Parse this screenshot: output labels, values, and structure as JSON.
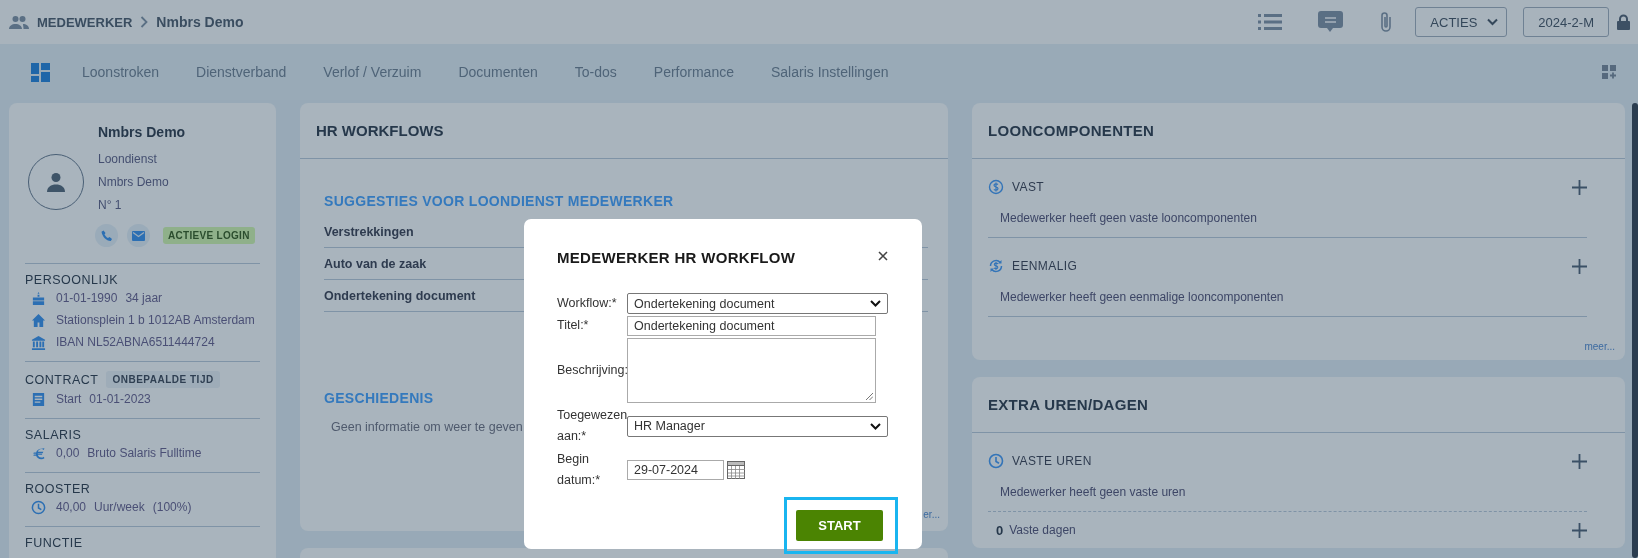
{
  "breadcrumb": {
    "section": "MEDEWERKER",
    "page": "Nmbrs Demo"
  },
  "header_buttons": {
    "actions": "ACTIES",
    "period": "2024-2-M"
  },
  "tabs": [
    {
      "kind": "icon",
      "selected": true
    },
    {
      "kind": "text",
      "label": "Loonstroken",
      "selected": false
    },
    {
      "kind": "text",
      "label": "Dienstverband",
      "selected": false
    },
    {
      "kind": "text",
      "label": "Verlof / Verzuim",
      "selected": false
    },
    {
      "kind": "text",
      "label": "Documenten",
      "selected": false
    },
    {
      "kind": "text",
      "label": "To-dos",
      "selected": false
    },
    {
      "kind": "text",
      "label": "Performance",
      "selected": false
    },
    {
      "kind": "text",
      "label": "Salaris Instellingen",
      "selected": false
    }
  ],
  "profile": {
    "name": "Nmbrs Demo",
    "lines": [
      "Loondienst",
      "Nmbrs Demo",
      "N° 1"
    ],
    "badge": "ACTIEVE LOGIN",
    "sections": [
      {
        "title": "PERSOONLIJK",
        "rows": [
          {
            "parts": [
              "01-01-1990",
              "34 jaar"
            ]
          },
          {
            "parts": [
              "Stationsplein 1 b 1012AB Amsterdam"
            ]
          },
          {
            "parts": [
              "IBAN NL52ABNA6511444724"
            ]
          }
        ]
      },
      {
        "title": "CONTRACT",
        "tag": "ONBEPAALDE TIJD",
        "rows": [
          {
            "parts": [
              "Start",
              "01-01-2023"
            ]
          }
        ]
      },
      {
        "title": "SALARIS",
        "rows": [
          {
            "parts": [
              "0,00",
              "Bruto Salaris Fulltime"
            ]
          }
        ]
      },
      {
        "title": "ROOSTER",
        "rows": [
          {
            "parts": [
              "40,00",
              "Uur/week",
              "(100%)"
            ]
          }
        ]
      },
      {
        "title": "FUNCTIE"
      }
    ]
  },
  "hr_workflows": {
    "title": "HR WORKFLOWS",
    "suggestions_title": "SUGGESTIES VOOR LOONDIENST MEDEWERKER",
    "suggestions": [
      "Verstrekkingen",
      "Auto van de zaak",
      "Ondertekening document"
    ],
    "history_title": "GESCHIEDENIS",
    "history_empty": "Geen informatie om weer te geven",
    "more_link": "er..."
  },
  "looncomponenten": {
    "title": "LOONCOMPONENTEN",
    "groups": [
      {
        "title": "VAST",
        "empty": "Medewerker heeft geen vaste looncomponenten"
      },
      {
        "title": "EENMALIG",
        "empty": "Medewerker heeft geen eenmalige looncomponenten"
      }
    ],
    "more_link": "meer..."
  },
  "extra_uren": {
    "title": "EXTRA UREN/DAGEN",
    "groups": [
      {
        "title": "VASTE UREN",
        "empty": "Medewerker heeft geen vaste uren"
      }
    ],
    "count": "0",
    "count_label": "Vaste dagen"
  },
  "modal": {
    "title": "MEDEWERKER HR WORKFLOW",
    "fields": [
      {
        "kind": "select",
        "label": "Workflow:*",
        "value": "Ondertekening document"
      },
      {
        "kind": "text",
        "label": "Titel:*",
        "value": "Ondertekening document"
      },
      {
        "kind": "textarea",
        "label": "Beschrijving:"
      },
      {
        "kind": "select",
        "label": "Toegewezen aan:*",
        "value": "HR Manager"
      },
      {
        "kind": "date",
        "label": "Begin datum:*",
        "value": "29-07-2024"
      }
    ],
    "submit": "START",
    "submit_highlighted": true
  }
}
